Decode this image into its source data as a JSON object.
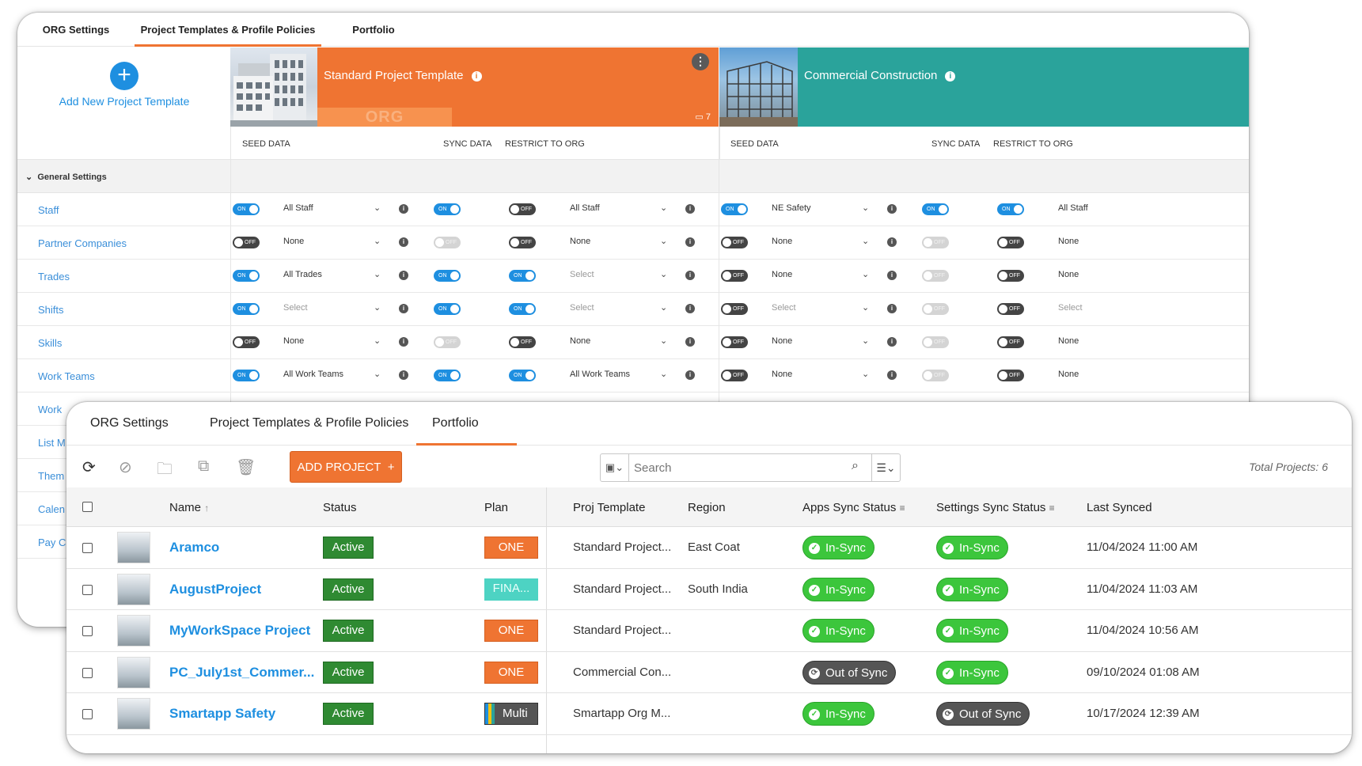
{
  "back": {
    "tabs": [
      "ORG Settings",
      "Project Templates & Profile Policies",
      "Portfolio"
    ],
    "add_template_label": "Add New Project Template",
    "templates": [
      {
        "title": "Standard Project Template",
        "org_label": "ORG",
        "count": "7"
      },
      {
        "title": "Commercial Construction"
      }
    ],
    "col_headers": {
      "seed": "SEED DATA",
      "sync": "SYNC DATA",
      "restrict": "RESTRICT TO ORG"
    },
    "section_label": "General Settings",
    "row_names": [
      "Staff",
      "Partner Companies",
      "Trades",
      "Shifts",
      "Skills",
      "Work Teams",
      "Work",
      "List M",
      "Them",
      "Calen",
      "Pay C"
    ],
    "rows": [
      {
        "t1_seed": "on",
        "t1_val": "All Staff",
        "t1_sync": "on",
        "t1_restrict": "off",
        "t1_rval": "All Staff",
        "t2_seed": "on",
        "t2_val": "NE Safety",
        "t2_sync": "on",
        "t2_restrict": "on",
        "t2_rval": "All Staff"
      },
      {
        "t1_seed": "off",
        "t1_val": "None",
        "t1_sync": "dis",
        "t1_restrict": "off",
        "t1_rval": "None",
        "t2_seed": "off",
        "t2_val": "None",
        "t2_sync": "dis",
        "t2_restrict": "off",
        "t2_rval": "None"
      },
      {
        "t1_seed": "on",
        "t1_val": "All Trades",
        "t1_sync": "on",
        "t1_restrict": "on",
        "t1_rval": "Select",
        "t2_seed": "off",
        "t2_val": "None",
        "t2_sync": "dis",
        "t2_restrict": "off",
        "t2_rval": "None"
      },
      {
        "t1_seed": "on",
        "t1_val": "Select",
        "t1_sync": "on",
        "t1_restrict": "on",
        "t1_rval": "Select",
        "t2_seed": "off",
        "t2_val": "Select",
        "t2_sync": "dis",
        "t2_restrict": "off",
        "t2_rval": "Select"
      },
      {
        "t1_seed": "off",
        "t1_val": "None",
        "t1_sync": "dis",
        "t1_restrict": "off",
        "t1_rval": "None",
        "t2_seed": "off",
        "t2_val": "None",
        "t2_sync": "dis",
        "t2_restrict": "off",
        "t2_rval": "None"
      },
      {
        "t1_seed": "on",
        "t1_val": "All Work Teams",
        "t1_sync": "on",
        "t1_restrict": "on",
        "t1_rval": "All Work Teams",
        "t2_seed": "off",
        "t2_val": "None",
        "t2_sync": "dis",
        "t2_restrict": "off",
        "t2_rval": "None"
      }
    ],
    "toggle_on": "ON",
    "toggle_off": "OFF"
  },
  "front": {
    "tabs": [
      "ORG Settings",
      "Project Templates & Profile Policies",
      "Portfolio"
    ],
    "add_project_label": "ADD PROJECT",
    "search_placeholder": "Search",
    "total_projects": "Total Projects:  6",
    "columns": [
      "Name",
      "Status",
      "Plan",
      "Proj Template",
      "Region",
      "Apps Sync Status",
      "Settings Sync Status",
      "Last Synced"
    ],
    "projects": [
      {
        "name": "Aramco",
        "status": "Active",
        "plan": "ONE",
        "plan_kind": "one",
        "template": "Standard Project...",
        "region": "East Coat",
        "apps_sync": "In-Sync",
        "apps_kind": "in",
        "settings_sync": "In-Sync",
        "settings_kind": "in",
        "last_synced": "11/04/2024 11:00 AM"
      },
      {
        "name": "AugustProject",
        "status": "Active",
        "plan": "FINA...",
        "plan_kind": "fina",
        "template": "Standard Project...",
        "region": "South India",
        "apps_sync": "In-Sync",
        "apps_kind": "in",
        "settings_sync": "In-Sync",
        "settings_kind": "in",
        "last_synced": "11/04/2024 11:03 AM"
      },
      {
        "name": "MyWorkSpace Project",
        "status": "Active",
        "plan": "ONE",
        "plan_kind": "one",
        "template": "Standard Project...",
        "region": "",
        "apps_sync": "In-Sync",
        "apps_kind": "in",
        "settings_sync": "In-Sync",
        "settings_kind": "in",
        "last_synced": "11/04/2024 10:56 AM"
      },
      {
        "name": "PC_July1st_Commer...",
        "status": "Active",
        "plan": "ONE",
        "plan_kind": "one",
        "template": "Commercial Con...",
        "region": "",
        "apps_sync": "Out of Sync",
        "apps_kind": "out",
        "settings_sync": "In-Sync",
        "settings_kind": "in",
        "last_synced": "09/10/2024 01:08 AM"
      },
      {
        "name": "Smartapp Safety",
        "status": "Active",
        "plan": "Multi",
        "plan_kind": "multi",
        "template": "Smartapp Org M...",
        "region": "",
        "apps_sync": "In-Sync",
        "apps_kind": "in",
        "settings_sync": "Out of Sync",
        "settings_kind": "out",
        "last_synced": "10/17/2024 12:39 AM"
      }
    ]
  }
}
